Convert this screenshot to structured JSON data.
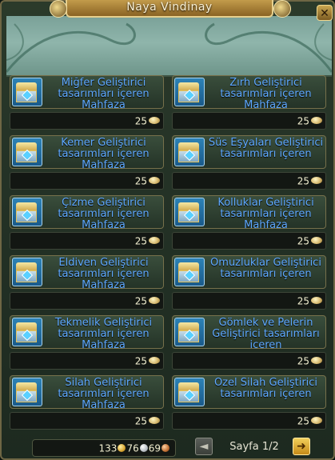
{
  "window": {
    "title": "Naya Vindinay",
    "close_label": "✕"
  },
  "items": [
    {
      "name": "Miğfer Geliştirici tasarımları içeren Mahfaza",
      "price": "25"
    },
    {
      "name": "Zırh Geliştirici tasarımları içeren Mahfaza",
      "price": "25"
    },
    {
      "name": "Kemer Geliştirici tasarımları içeren Mahfaza",
      "price": "25"
    },
    {
      "name": "Süs Eşyaları Geliştirici tasarımları içeren",
      "price": "25"
    },
    {
      "name": "Çizme Geliştirici tasarımları içeren Mahfaza",
      "price": "25"
    },
    {
      "name": "Kolluklar Geliştirici tasarımları içeren Mahfaza",
      "price": "25"
    },
    {
      "name": "Eldiven Geliştirici tasarımları içeren Mahfaza",
      "price": "25"
    },
    {
      "name": "Omuzluklar Geliştirici tasarımları içeren",
      "price": "25"
    },
    {
      "name": "Tekmelik Geliştirici tasarımları içeren Mahfaza",
      "price": "25"
    },
    {
      "name": "Gömlek ve Pelerin Geliştirici tasarımları içeren",
      "price": "25"
    },
    {
      "name": "Silah Geliştirici tasarımları içeren Mahfaza",
      "price": "25"
    },
    {
      "name": "Özel Silah Geliştirici tasarımları içeren",
      "price": "25"
    }
  ],
  "wallet": {
    "gold": "133",
    "silver": "76",
    "copper": "69"
  },
  "pagination": {
    "label": "Sayfa 1/2",
    "prev_symbol": "◄",
    "next_symbol": "➜"
  },
  "icons": {
    "item_icon": "chest-icon",
    "price_icon": "gold-ore-icon"
  },
  "colors": {
    "item_name": "#5ea8ff",
    "frame_border": "#6e6644",
    "title_plate": "#c8a14f"
  }
}
